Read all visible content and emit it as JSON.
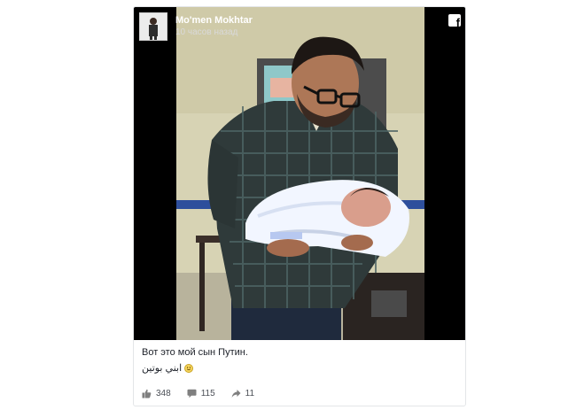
{
  "post": {
    "author": "Mo'men Mokhtar",
    "time": "10 часов назад",
    "caption": "Вот это мой сын Путин.",
    "caption_arabic": "ابني بوتين",
    "emoji": "smile-emoji"
  },
  "stats": {
    "likes": "348",
    "comments": "115",
    "shares": "11"
  },
  "icons": {
    "brand": "facebook-icon",
    "like": "thumbs-up-icon",
    "comment": "comment-icon",
    "share": "share-arrow-icon"
  },
  "colors": {
    "media_background": "#000000",
    "text": "#1d2129",
    "meta_text": "#4b4f56"
  }
}
